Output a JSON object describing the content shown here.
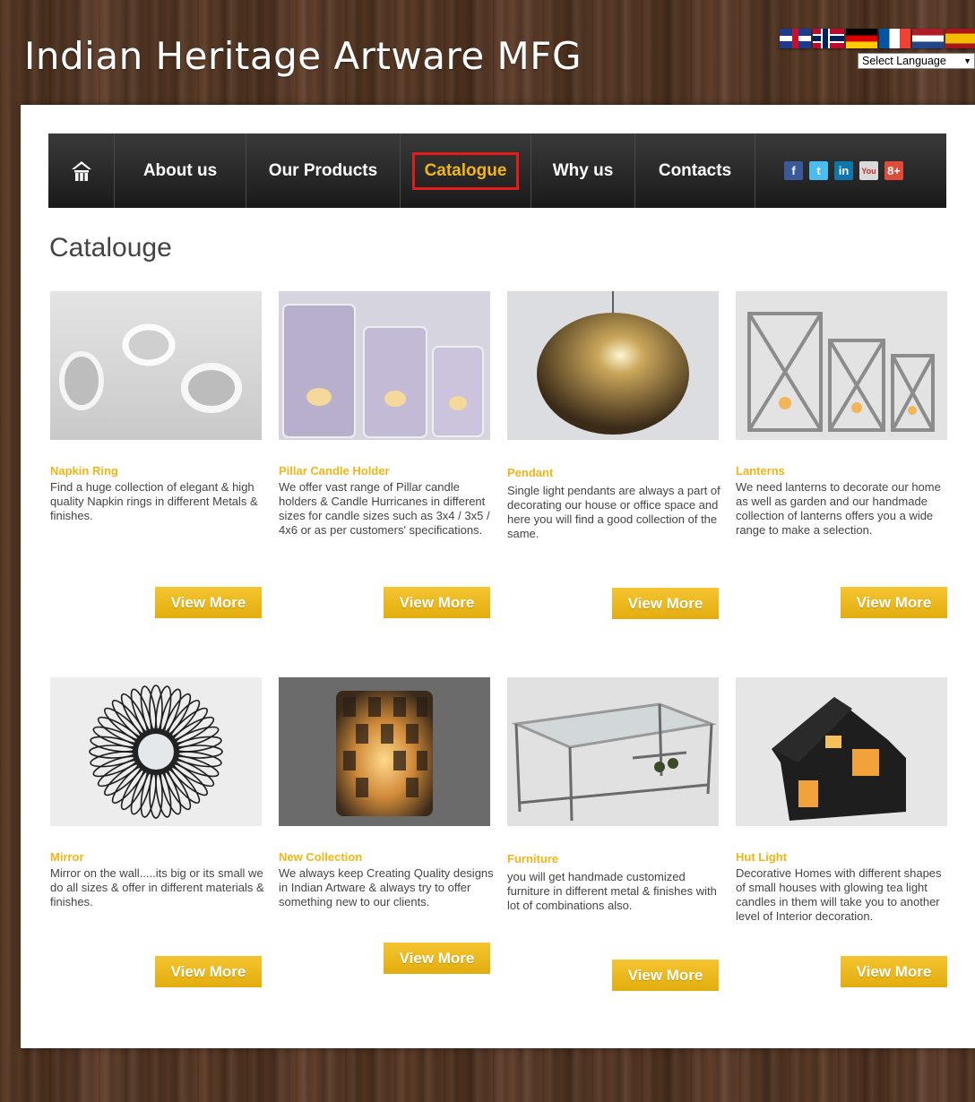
{
  "header": {
    "site_title": "Indian Heritage Artware MFG",
    "language_select": "Select Language",
    "flags": [
      "uk-flag-icon",
      "norway-flag-icon",
      "germany-flag-icon",
      "france-flag-icon",
      "netherlands-flag-icon",
      "spain-flag-icon"
    ]
  },
  "nav": {
    "home_icon": "home-icon",
    "items": [
      "About us",
      "Our Products",
      "Catalogue",
      "Why us",
      "Contacts"
    ],
    "active": "Catalogue",
    "social": {
      "facebook": "f",
      "twitter": "t",
      "linkedin": "in",
      "youtube": "You",
      "googleplus": "8+"
    }
  },
  "page": {
    "heading": "Catalouge"
  },
  "products": [
    {
      "title": "Napkin Ring",
      "description": "Find a huge collection of elegant & high quality Napkin rings in different Metals & finishes.",
      "button": "View More"
    },
    {
      "title": "Pillar Candle Holder",
      "description": "We offer vast range of Pillar candle holders & Candle Hurricanes in different sizes for candle sizes such as 3x4 / 3x5 / 4x6 or as per customers' specifications.",
      "button": "View More"
    },
    {
      "title": "Pendant",
      "description": "Single light pendants are always a part of decorating our house or office space and here you will find a good collection of the same.",
      "button": "View More"
    },
    {
      "title": "Lanterns",
      "description": "We need lanterns to decorate our home as well as garden and our handmade collection of lanterns offers you a wide range to make a selection.",
      "button": "View More"
    },
    {
      "title": "Mirror",
      "description": "Mirror on the wall.....its big or its small we do all sizes & offer in different materials & finishes.",
      "button": "View More"
    },
    {
      "title": "New Collection",
      "description": "We always keep Creating Quality designs in Indian Artware & always try to offer something new to our clients.",
      "button": "View More"
    },
    {
      "title": "Furniture",
      "description": "you will get handmade customized furniture in different metal & finishes with lot of combinations also.",
      "button": "View More"
    },
    {
      "title": "Hut Light",
      "description": "Decorative Homes with different shapes of small houses with glowing tea light candles in them will take you to another level of Interior decoration.",
      "button": "View More"
    }
  ],
  "colors": {
    "accent": "#f2b517",
    "nav_bg": "#1a1a1a",
    "active_outline": "#e31b1b",
    "button": "#e8b31a"
  }
}
